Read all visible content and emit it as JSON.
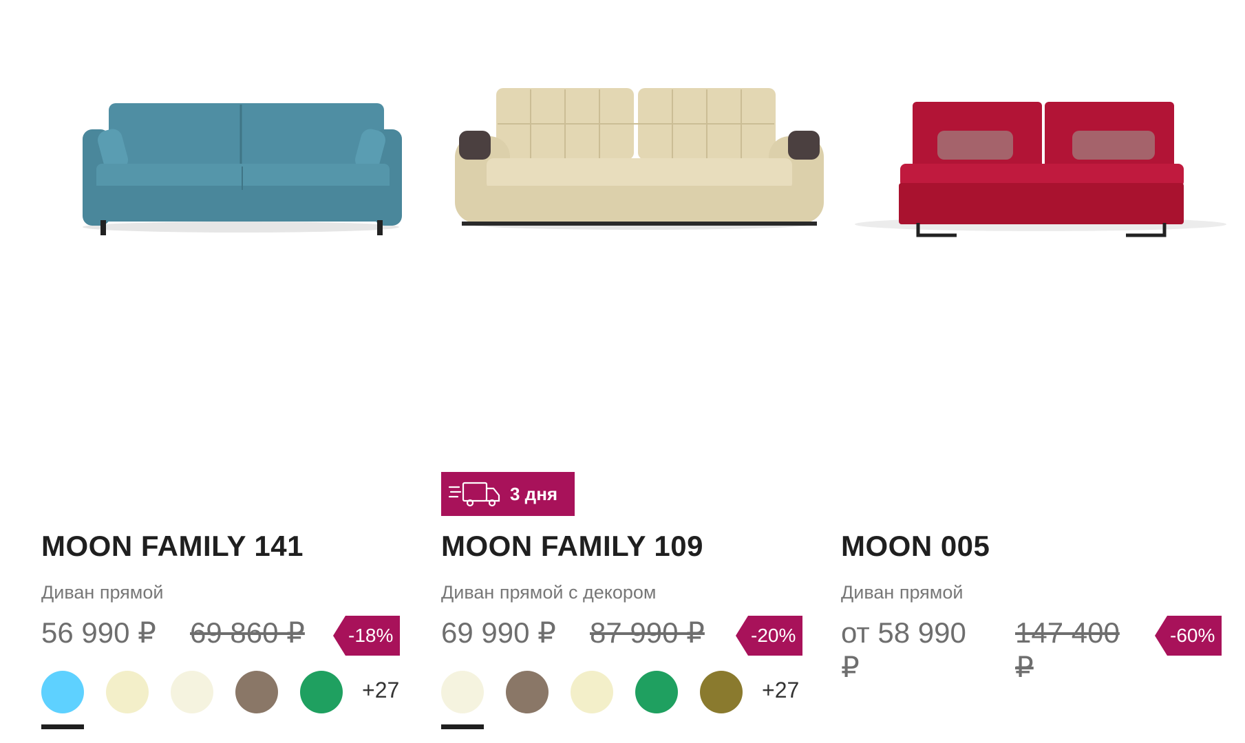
{
  "products": [
    {
      "name": "MOON FAMILY 141",
      "type": "Диван прямой",
      "price": "56 990 ₽",
      "old_price": "69 860 ₽",
      "discount": "-18%",
      "more_colors": "+27",
      "sofa_color": "#4f8ea3",
      "swatches": [
        "#5ed1ff",
        "#f3efc9",
        "#f5f3df",
        "#8a7767",
        "#1fa060"
      ]
    },
    {
      "name": "MOON FAMILY 109",
      "type": "Диван прямой с декором",
      "price": "69 990 ₽",
      "old_price": "87 990 ₽",
      "discount": "-20%",
      "more_colors": "+27",
      "delivery_badge": "3 дня",
      "sofa_color": "#e3d7b3",
      "swatches": [
        "#f5f3df",
        "#8a7767",
        "#f3efc9",
        "#1fa060",
        "#8a7a2e"
      ]
    },
    {
      "name": "MOON 005",
      "type": "Диван прямой",
      "price": "от 58 990 ₽",
      "old_price": "147 400 ₽",
      "discount": "-60%",
      "sofa_color": "#b21436"
    }
  ],
  "colors": {
    "accent": "#a8125a",
    "price_text": "#6e6e6e",
    "title_text": "#1f1f1f"
  }
}
